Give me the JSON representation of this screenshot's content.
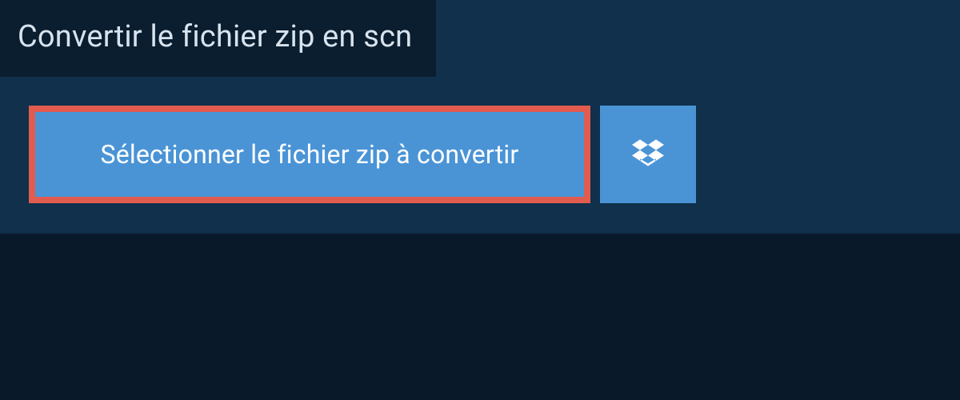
{
  "header": {
    "title": "Convertir le fichier zip en scn"
  },
  "actions": {
    "select_file_label": "Sélectionner le fichier zip à convertir"
  },
  "colors": {
    "background_dark": "#0a1929",
    "panel": "#10304b",
    "title_bg": "#0a1e30",
    "button_primary": "#4a94d6",
    "highlight_border": "#e25b4f",
    "text_light": "#d8e3ed",
    "text_white": "#ffffff"
  }
}
